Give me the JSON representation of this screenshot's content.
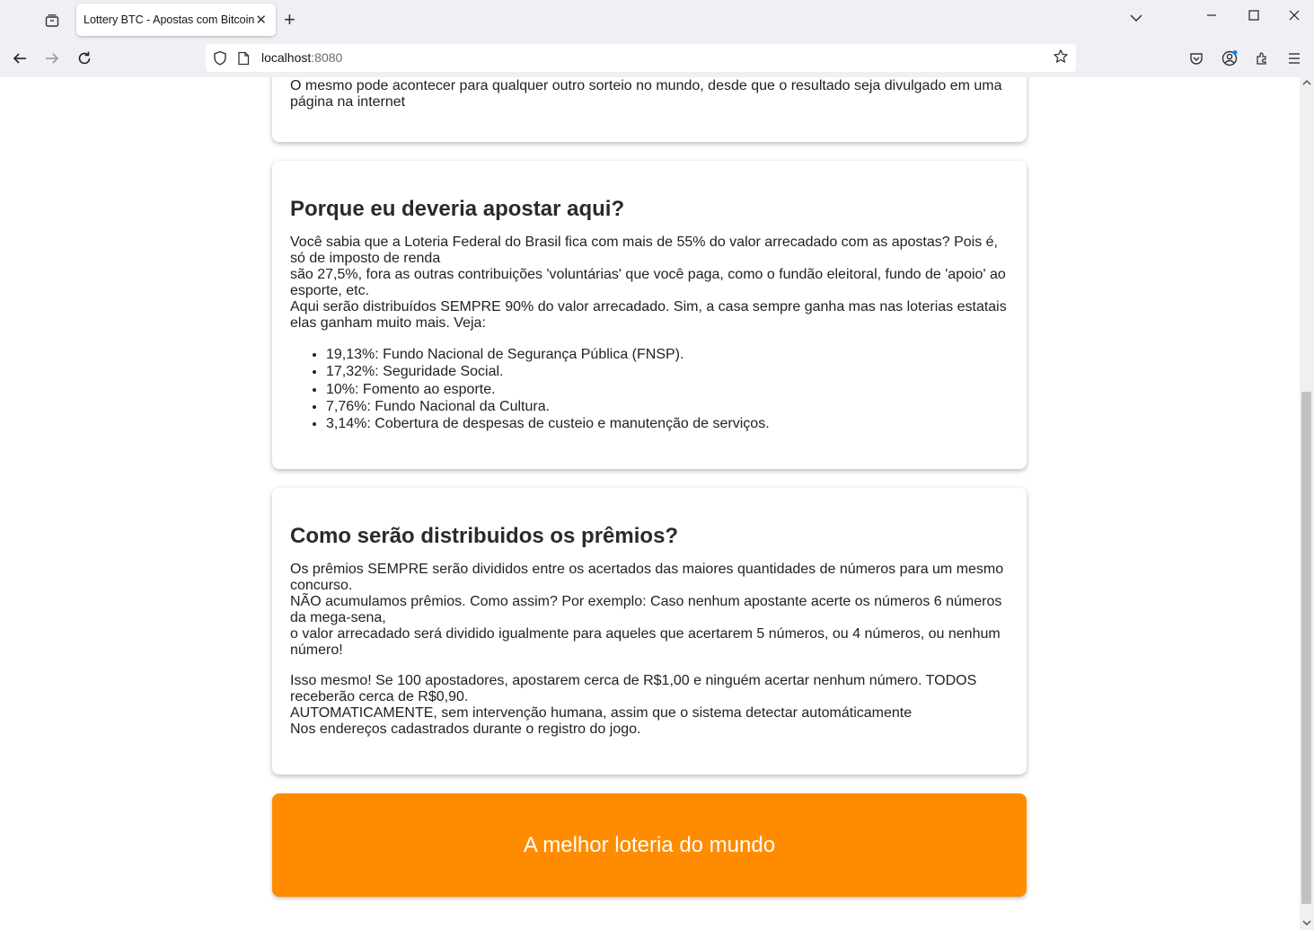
{
  "browser": {
    "tab_title": "Lottery BTC - Apostas com Bitcoin",
    "tab_close": "✕",
    "new_tab": "+",
    "url_host": "localhost",
    "url_port": ":8080"
  },
  "card1": {
    "text_lines": [
      "O mesmo pode acontecer para qualquer outro sorteio no mundo, desde que o resultado seja divulgado em uma",
      "página na internet"
    ]
  },
  "card2": {
    "title": "Porque eu deveria apostar aqui?",
    "text_lines": [
      "Você sabia que a Loteria Federal do Brasil fica com mais de 55% do valor arrecadado com as apostas? Pois é,",
      "só de imposto de renda",
      "são 27,5%, fora as outras contribuições 'voluntárias' que você paga, como o fundão eleitoral, fundo de 'apoio' ao",
      "esporte, etc.",
      "Aqui serão distribuídos SEMPRE 90% do valor arrecadado. Sim, a casa sempre ganha mas nas loterias estatais",
      "elas ganham muito mais. Veja:"
    ],
    "items": [
      "19,13%: Fundo Nacional de Segurança Pública (FNSP).",
      "17,32%: Seguridade Social.",
      "10%: Fomento ao esporte.",
      "7,76%: Fundo Nacional da Cultura.",
      "3,14%: Cobertura de despesas de custeio e manutenção de serviços."
    ]
  },
  "card3": {
    "title": "Como serão distribuidos os prêmios?",
    "text_lines": [
      "Os prêmios SEMPRE serão divididos entre os acertados das maiores quantidades de números para um mesmo",
      "concurso.",
      "NÃO acumulamos prêmios. Como assim? Por exemplo: Caso nenhum apostante acerte os números 6 números",
      "da mega-sena,",
      "o valor arrecadado será dividido igualmente para aqueles que acertarem 5 números, ou 4 números, ou nenhum",
      "número!"
    ],
    "text_lines2": [
      "Isso mesmo! Se 100 apostadores, apostarem cerca de R$1,00 e ninguém acertar nenhum número. TODOS",
      "receberão cerca de R$0,90.",
      "AUTOMATICAMENTE, sem intervenção humana, assim que o sistema detectar automáticamente",
      "Nos endereços cadastrados durante o registro do jogo."
    ]
  },
  "footer": {
    "text": "A melhor loteria do mundo",
    "color": "#ff8c00"
  }
}
